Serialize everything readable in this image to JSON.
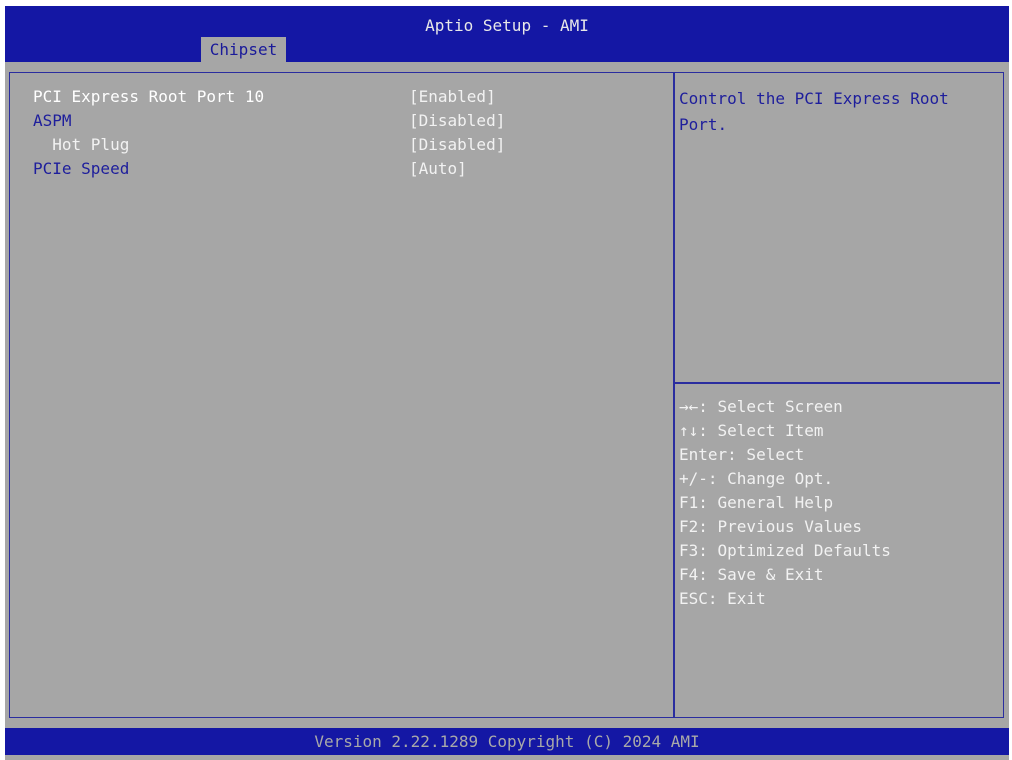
{
  "header": {
    "title": "Aptio Setup - AMI",
    "active_tab": "Chipset"
  },
  "settings": [
    {
      "label": "PCI Express Root Port 10",
      "value": "[Enabled]",
      "selected": true
    },
    {
      "label": "ASPM",
      "value": "[Disabled]"
    },
    {
      "label": "  Hot Plug",
      "value": "[Disabled]"
    },
    {
      "label": "PCIe Speed",
      "value": "[Auto]"
    }
  ],
  "help": {
    "text": "Control the PCI Express Root Port."
  },
  "keys": [
    "→←: Select Screen",
    "↑↓: Select Item",
    "Enter: Select",
    "+/-: Change Opt.",
    "F1: General Help",
    "F2: Previous Values",
    "F3: Optimized Defaults",
    "F4: Save & Exit",
    "ESC: Exit"
  ],
  "footer": {
    "version": "Version 2.22.1289 Copyright (C) 2024 AMI"
  },
  "colors": {
    "bar": "#1417a4",
    "panel": "#a6a6a6",
    "link_text": "#1e1e9c",
    "selected_text": "#ffffff"
  }
}
